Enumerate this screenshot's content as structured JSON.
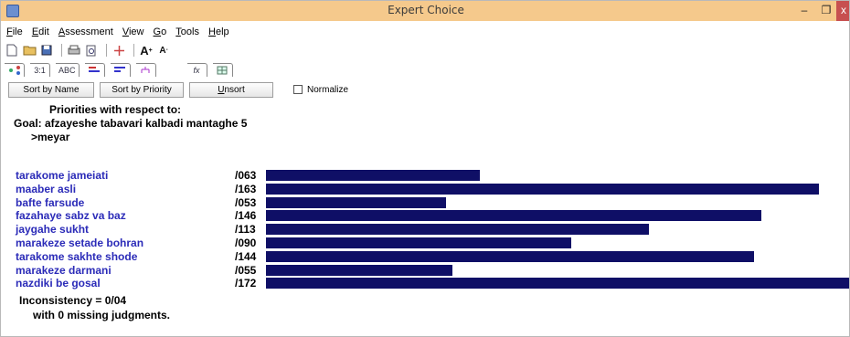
{
  "window": {
    "title": "Expert Choice",
    "minimize": "–",
    "maximize": "❐",
    "close": "x"
  },
  "menu": [
    "File",
    "Edit",
    "Assessment",
    "View",
    "Go",
    "Tools",
    "Help"
  ],
  "toolbar2": {
    "ratio_tab": "3:1",
    "abc_tab": "ABC",
    "formula_tab": "fx"
  },
  "sort_bar": {
    "sort_by_name": "Sort by Name",
    "sort_by_priority": "Sort by Priority",
    "unsort": "Unsort",
    "normalize": "Normalize",
    "normalize_checked": false
  },
  "priorities": {
    "heading": "Priorities with respect to:",
    "goal": "Goal: afzayeshe tabavari kalbadi mantaghe 5",
    "node": ">meyar",
    "items": [
      {
        "label": "tarakome jameiati",
        "value_text": "/063",
        "value": 0.063
      },
      {
        "label": "maaber asli",
        "value_text": "/163",
        "value": 0.163
      },
      {
        "label": "bafte farsude",
        "value_text": "/053",
        "value": 0.053
      },
      {
        "label": "fazahaye sabz va baz",
        "value_text": "/146",
        "value": 0.146
      },
      {
        "label": "jaygahe sukht",
        "value_text": "/113",
        "value": 0.113
      },
      {
        "label": "marakeze setade bohran",
        "value_text": "/090",
        "value": 0.09
      },
      {
        "label": "tarakome sakhte shode",
        "value_text": "/144",
        "value": 0.144
      },
      {
        "label": "marakeze darmani",
        "value_text": "/055",
        "value": 0.055
      },
      {
        "label": "nazdiki be gosal",
        "value_text": "/172",
        "value": 0.172
      }
    ],
    "bar_color": "#0f0f66",
    "label_color": "#2b2bb8",
    "inconsistency": "Inconsistency = 0/04",
    "missing": "with 0  missing judgments."
  }
}
